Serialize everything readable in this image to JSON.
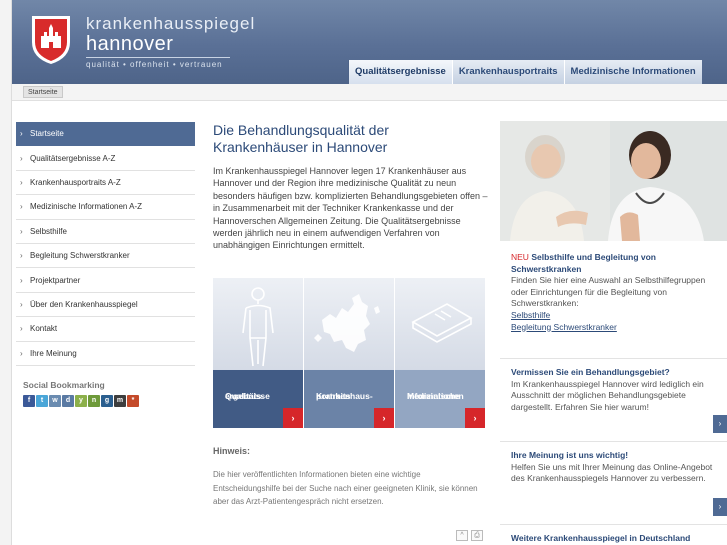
{
  "brand": {
    "name": "krankenhausspiegel",
    "city": "hannover",
    "tagline": "qualität • offenheit • vertrauen"
  },
  "topnav": [
    {
      "label": "Qualitätsergebnisse",
      "active": true
    },
    {
      "label": "Krankenhausportraits",
      "active": false
    },
    {
      "label": "Medizinische Informationen",
      "active": false
    }
  ],
  "breadcrumb": "Startseite",
  "sidenav": [
    {
      "label": "Startseite"
    },
    {
      "label": "Qualitätsergebnisse A-Z"
    },
    {
      "label": "Krankenhausportraits A-Z"
    },
    {
      "label": "Medizinische Informationen A-Z"
    },
    {
      "label": "Selbsthilfe"
    },
    {
      "label": "Begleitung Schwerstkranker"
    },
    {
      "label": "Projektpartner"
    },
    {
      "label": "Über den Krankenhausspiegel"
    },
    {
      "label": "Kontakt"
    },
    {
      "label": "Ihre Meinung"
    }
  ],
  "social": {
    "title": "Social Bookmarking",
    "icons": [
      {
        "name": "facebook-icon",
        "glyph": "f",
        "color": "#3b5998"
      },
      {
        "name": "twitter-icon",
        "glyph": "t",
        "color": "#4aa6d8"
      },
      {
        "name": "mrwong-icon",
        "glyph": "w",
        "color": "#6a8bb0"
      },
      {
        "name": "delicious-icon",
        "glyph": "d",
        "color": "#5a7aa3"
      },
      {
        "name": "yigg-icon",
        "glyph": "y",
        "color": "#8cb04a"
      },
      {
        "name": "webnews-icon",
        "glyph": "n",
        "color": "#6e9a3a"
      },
      {
        "name": "digg-icon",
        "glyph": "g",
        "color": "#2b5f8f"
      },
      {
        "name": "misterwong-icon",
        "glyph": "m",
        "color": "#3e3e3e"
      },
      {
        "name": "bookmark-icon",
        "glyph": "*",
        "color": "#c44a2a"
      }
    ]
  },
  "main": {
    "title": "Die Behandlungsqualität der Krankenhäuser in Hannover",
    "intro": "Im Krankenhausspiegel Hannover legen 17 Krankenhäuser aus Hannover und der Region ihre medizinische Qualität zu neun besonders häufigen bzw. komplizierten Behandlungsgebieten offen – in Zusammenarbeit mit der Techniker Krankenkasse und der Hannoverschen Allgemeinen Zeitung. Die Qualitätsergebnisse werden jährlich neu in einem aufwendigen Verfahren von unabhängigen Einrichtungen ermittelt.",
    "features": [
      {
        "line1": "Qualitäts-",
        "line2": "ergebnisse"
      },
      {
        "line1": "Krankenhaus-",
        "line2": "portraits"
      },
      {
        "line1": "Medizinische",
        "line2": "Informationen"
      }
    ],
    "go_glyph": "›",
    "hint_title": "Hinweis:",
    "hint_text": "Die hier veröffentlichten Informationen bieten eine wichtige Entscheidungshilfe bei der Suche nach einer geeigneten Klinik, sie können aber das Arzt-Patientengespräch nicht ersetzen.",
    "tools": [
      "^",
      "⎙"
    ]
  },
  "right": {
    "block1": {
      "new_label": "NEU",
      "title": "Selbsthilfe und Begleitung von Schwerstkranken",
      "text": "Finden Sie hier eine Auswahl an Selbsthilfegruppen oder Einrichtungen für die Begleitung von Schwerstkranken:",
      "link1": "Selbsthilfe",
      "link2": "Begleitung Schwerstkranker"
    },
    "block2": {
      "title": "Vermissen Sie ein Behandlungsgebiet?",
      "text": "Im Krankenhausspiegel Hannover wird lediglich ein Ausschnitt der möglichen Behandlungsgebiete dargestellt. Erfahren Sie hier warum!"
    },
    "block3": {
      "title": "Ihre Meinung ist uns wichtig!",
      "text": "Helfen Sie uns mit Ihrer Meinung das Online-Angebot des Krankenhausspiegels Hannover zu verbessern."
    },
    "block4": {
      "title": "Weitere Krankenhausspiegel in Deutschland"
    }
  }
}
